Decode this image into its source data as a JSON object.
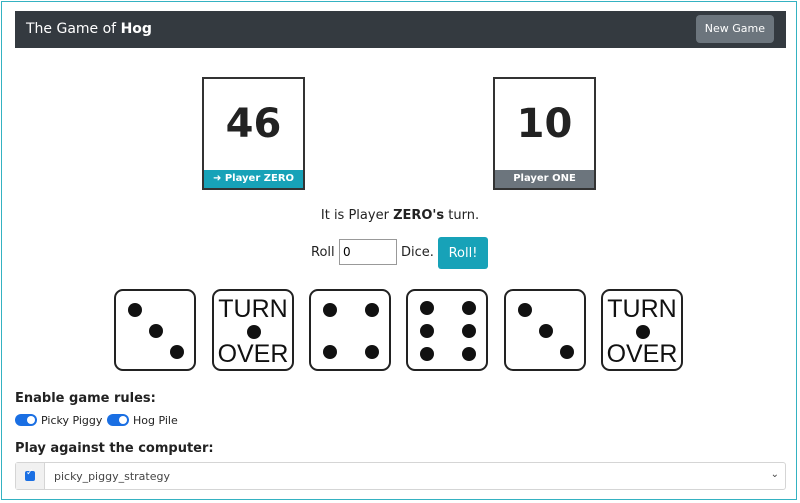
{
  "header": {
    "title_prefix": "The Game of",
    "title_bold": "Hog",
    "new_game_label": "New Game"
  },
  "scores": [
    {
      "value": "46",
      "label": "➜ Player ZERO",
      "active": true
    },
    {
      "value": "10",
      "label": "Player ONE",
      "active": false
    }
  ],
  "turn": {
    "prefix": "It is Player",
    "player": "ZERO's",
    "suffix": "turn."
  },
  "roll": {
    "label_before": "Roll",
    "value": "0",
    "label_after": "Dice.",
    "button": "Roll!"
  },
  "dice": [
    {
      "face": 3
    },
    {
      "face": "turn-over",
      "text_top": "TURN",
      "text_bottom": "OVER"
    },
    {
      "face": 4
    },
    {
      "face": 6
    },
    {
      "face": 3
    },
    {
      "face": "turn-over",
      "text_top": "TURN",
      "text_bottom": "OVER"
    }
  ],
  "rules": {
    "title": "Enable game rules:",
    "items": [
      {
        "label": "Picky Piggy",
        "enabled": true
      },
      {
        "label": "Hog Pile",
        "enabled": true
      }
    ]
  },
  "computer": {
    "title": "Play against the computer:",
    "enabled": true,
    "strategy": "picky_piggy_strategy"
  },
  "colors": {
    "accent": "#17a2b8",
    "navbar": "#343a40",
    "inactive": "#6c757d",
    "toggle": "#1a6fe3"
  }
}
